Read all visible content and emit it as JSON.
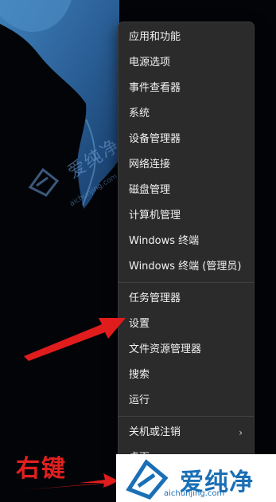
{
  "menu": {
    "items": [
      {
        "label": "应用和功能"
      },
      {
        "label": "电源选项"
      },
      {
        "label": "事件查看器"
      },
      {
        "label": "系统"
      },
      {
        "label": "设备管理器"
      },
      {
        "label": "网络连接"
      },
      {
        "label": "磁盘管理"
      },
      {
        "label": "计算机管理"
      },
      {
        "label": "Windows 终端"
      },
      {
        "label": "Windows 终端 (管理员)"
      },
      {
        "label": "任务管理器"
      },
      {
        "label": "设置"
      },
      {
        "label": "文件资源管理器"
      },
      {
        "label": "搜索"
      },
      {
        "label": "运行"
      },
      {
        "label": "关机或注销",
        "submenu_icon": "chevron-right-icon"
      },
      {
        "label": "桌面"
      }
    ]
  },
  "annotation": {
    "text": "右键",
    "color": "#e02020"
  },
  "watermark": {
    "name": "爱纯净",
    "url": "aichunjing.com"
  },
  "logo": {
    "name": "爱纯净",
    "url": "aichunjing.com",
    "color": "#1a6fb5"
  }
}
